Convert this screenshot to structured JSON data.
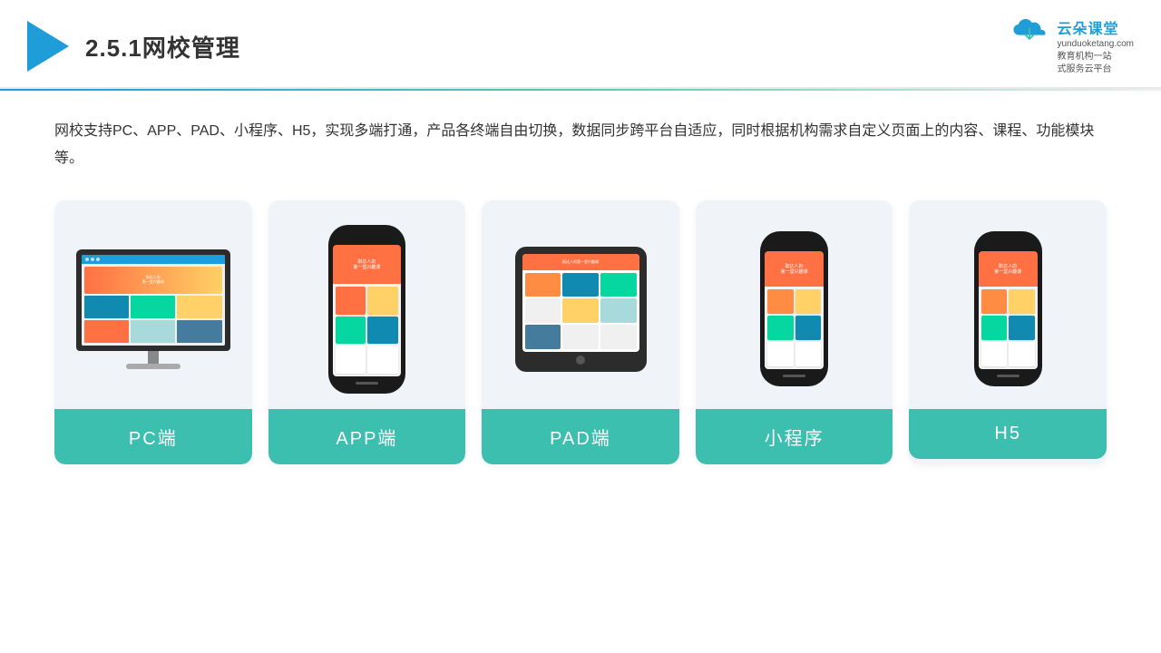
{
  "header": {
    "title": "2.5.1网校管理",
    "brand": {
      "name": "云朵课堂",
      "domain": "yunduoketang.com",
      "tagline_line1": "教育机构一站",
      "tagline_line2": "式服务云平台"
    }
  },
  "description": "网校支持PC、APP、PAD、小程序、H5，实现多端打通，产品各终端自由切换，数据同步跨平台自适应，同时根据机构需求自定义页面上的内容、课程、功能模块等。",
  "cards": [
    {
      "id": "pc",
      "label": "PC端"
    },
    {
      "id": "app",
      "label": "APP端"
    },
    {
      "id": "pad",
      "label": "PAD端"
    },
    {
      "id": "miniprogram",
      "label": "小程序"
    },
    {
      "id": "h5",
      "label": "H5"
    }
  ],
  "colors": {
    "accent": "#1e9dd8",
    "teal": "#3dbfb0",
    "header_divider_start": "#1e9dd8",
    "header_divider_end": "#5bc8af"
  }
}
